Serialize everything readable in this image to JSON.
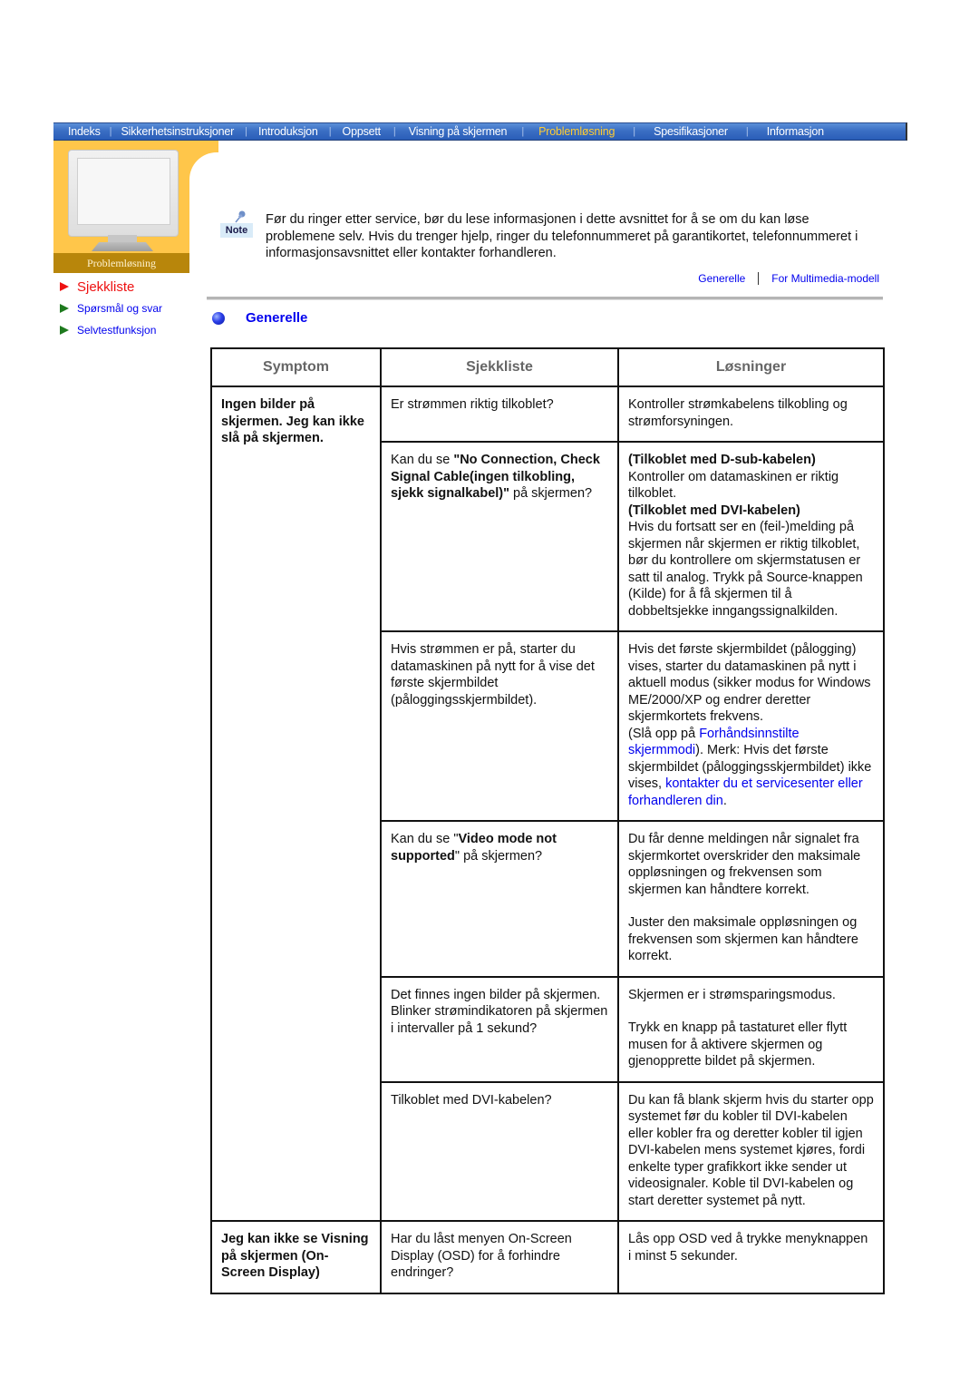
{
  "nav": {
    "items": [
      {
        "label": "Indeks",
        "active": false
      },
      {
        "label": "Sikkerhetsinstruksjoner",
        "active": false
      },
      {
        "label": "Introduksjon",
        "active": false
      },
      {
        "label": "Oppsett",
        "active": false
      },
      {
        "label": "Visning på skjermen",
        "active": false
      },
      {
        "label": "Problemløsning",
        "active": true
      },
      {
        "label": "Spesifikasjoner",
        "active": false
      },
      {
        "label": "Informasjon",
        "active": false
      }
    ],
    "colors": {
      "bar": "#3b6fc4",
      "active_text": "#ffcc33"
    }
  },
  "banner": {
    "label": "Problemløsning",
    "color": "#ffc64a"
  },
  "sidebar": {
    "items": [
      {
        "label": "Sjekkliste",
        "active": true
      },
      {
        "label": "Spørsmål og svar",
        "active": false
      },
      {
        "label": "Selvtestfunksjon",
        "active": false
      }
    ]
  },
  "note": {
    "icon_label": "Note",
    "text": "Før du ringer etter service, bør du lese informasjonen i dette avsnittet for å se om du kan løse problemene selv. Hvis du trenger hjelp, ringer du telefonnummeret på garantikortet, telefonnummeret i informasjonsavsnittet eller kontakter forhandleren."
  },
  "anchors": [
    {
      "label": "Generelle"
    },
    {
      "label": "For Multimedia-modell"
    }
  ],
  "section": {
    "title": "Generelle"
  },
  "table": {
    "headers": [
      "Symptom",
      "Sjekkliste",
      "Løsninger"
    ],
    "groups": [
      {
        "symptom": "Ingen bilder på skjermen. Jeg kan ikke slå på skjermen.",
        "rows": [
          {
            "check": [
              {
                "t": "Er strømmen riktig tilkoblet?"
              }
            ],
            "solution": [
              {
                "t": "Kontroller strømkabelens tilkobling og strømforsyningen."
              }
            ]
          },
          {
            "check": [
              {
                "t": "Kan du se "
              },
              {
                "t": "\"No Connection, Check Signal Cable(ingen tilkobling, sjekk signalkabel)\"",
                "b": true
              },
              {
                "t": " på skjermen?"
              }
            ],
            "solution": [
              {
                "t": "(Tilkoblet med D-sub-kabelen)",
                "b": true,
                "br": true
              },
              {
                "t": "Kontroller om datamaskinen er riktig tilkoblet.",
                "br": true
              },
              {
                "t": "(Tilkoblet med DVI-kabelen)",
                "b": true,
                "br": true
              },
              {
                "t": "Hvis du fortsatt ser en (feil-)melding på skjermen når skjermen er riktig tilkoblet, bør du kontrollere om skjermstatusen er satt til analog. Trykk på Source-knappen (Kilde) for å få skjermen til å dobbeltsjekke inngangssignalkilden."
              }
            ]
          },
          {
            "check": [
              {
                "t": "Hvis strømmen er på, starter du datamaskinen på nytt for å vise det første skjermbildet (påloggingsskjermbildet)."
              }
            ],
            "solution": [
              {
                "t": "Hvis det første skjermbildet (pålogging) vises, starter du datamaskinen på nytt i aktuell modus (sikker modus for Windows ME/2000/XP og endrer deretter skjermkortets frekvens.",
                "br": true
              },
              {
                "t": "(Slå opp på "
              },
              {
                "t": "Forhåndsinnstilte skjermmodi",
                "link": true
              },
              {
                "t": "). Merk: Hvis det første skjermbildet (påloggingsskjermbildet) ikke vises, "
              },
              {
                "t": "kontakter du et servicesenter eller forhandleren din",
                "link": true
              },
              {
                "t": "."
              }
            ]
          },
          {
            "check": [
              {
                "t": "Kan du se \""
              },
              {
                "t": "Video mode not supported",
                "b": true
              },
              {
                "t": "\" på skjermen?"
              }
            ],
            "solution": [
              {
                "t": "Du får denne meldingen når signalet fra skjermkortet overskrider den maksimale oppløsningen og frekvensen som skjermen kan håndtere korrekt.",
                "br": true,
                "gap": true
              },
              {
                "t": "Juster den maksimale oppløsningen og frekvensen som skjermen kan håndtere korrekt."
              }
            ]
          },
          {
            "check": [
              {
                "t": "Det finnes ingen bilder på skjermen. Blinker strømindikatoren på skjermen i intervaller på 1 sekund?"
              }
            ],
            "solution": [
              {
                "t": "Skjermen er i strømsparingsmodus.",
                "br": true,
                "gap": true
              },
              {
                "t": "Trykk en knapp på tastaturet eller flytt musen for å aktivere skjermen og gjenopprette bildet på skjermen."
              }
            ]
          },
          {
            "check": [
              {
                "t": "Tilkoblet med DVI-kabelen?"
              }
            ],
            "solution": [
              {
                "t": "Du kan få blank skjerm hvis du starter opp systemet før du kobler til DVI-kabelen eller kobler fra og deretter kobler til igjen DVI-kabelen mens systemet kjøres, fordi enkelte typer grafikkort ikke sender ut videosignaler. Koble til DVI-kabelen og start deretter systemet på nytt."
              }
            ]
          }
        ]
      },
      {
        "symptom": "Jeg kan ikke se Visning på skjermen (On-Screen Display)",
        "rows": [
          {
            "check": [
              {
                "t": "Har du låst menyen On-Screen Display (OSD) for å forhindre endringer?"
              }
            ],
            "solution": [
              {
                "t": "Lås opp OSD ved å trykke menyknappen i minst 5 sekunder."
              }
            ]
          }
        ]
      }
    ]
  }
}
